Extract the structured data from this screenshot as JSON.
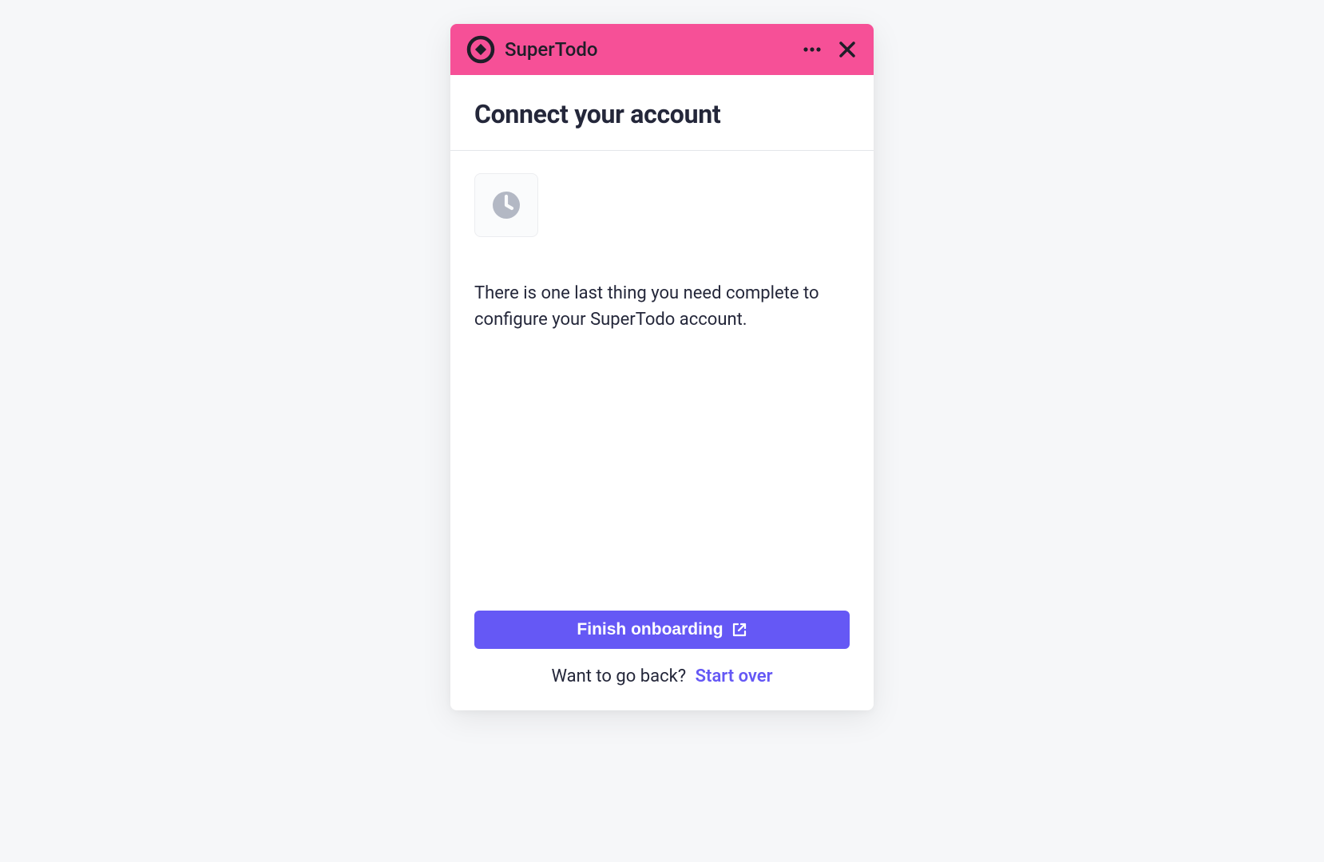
{
  "header": {
    "app_name": "SuperTodo",
    "icons": {
      "more": "more-icon",
      "close": "close-icon"
    }
  },
  "title": "Connect your account",
  "content": {
    "icon": "clock-icon",
    "description": "There is one last thing you need complete to configure your SuperTodo account."
  },
  "footer": {
    "primary_button_label": "Finish onboarding",
    "primary_button_icon": "external-link-icon",
    "back_prompt": "Want to go back?",
    "start_over_label": "Start over"
  },
  "colors": {
    "accent_pink": "#f65097",
    "accent_purple": "#6558f5",
    "text_dark": "#24273a"
  }
}
